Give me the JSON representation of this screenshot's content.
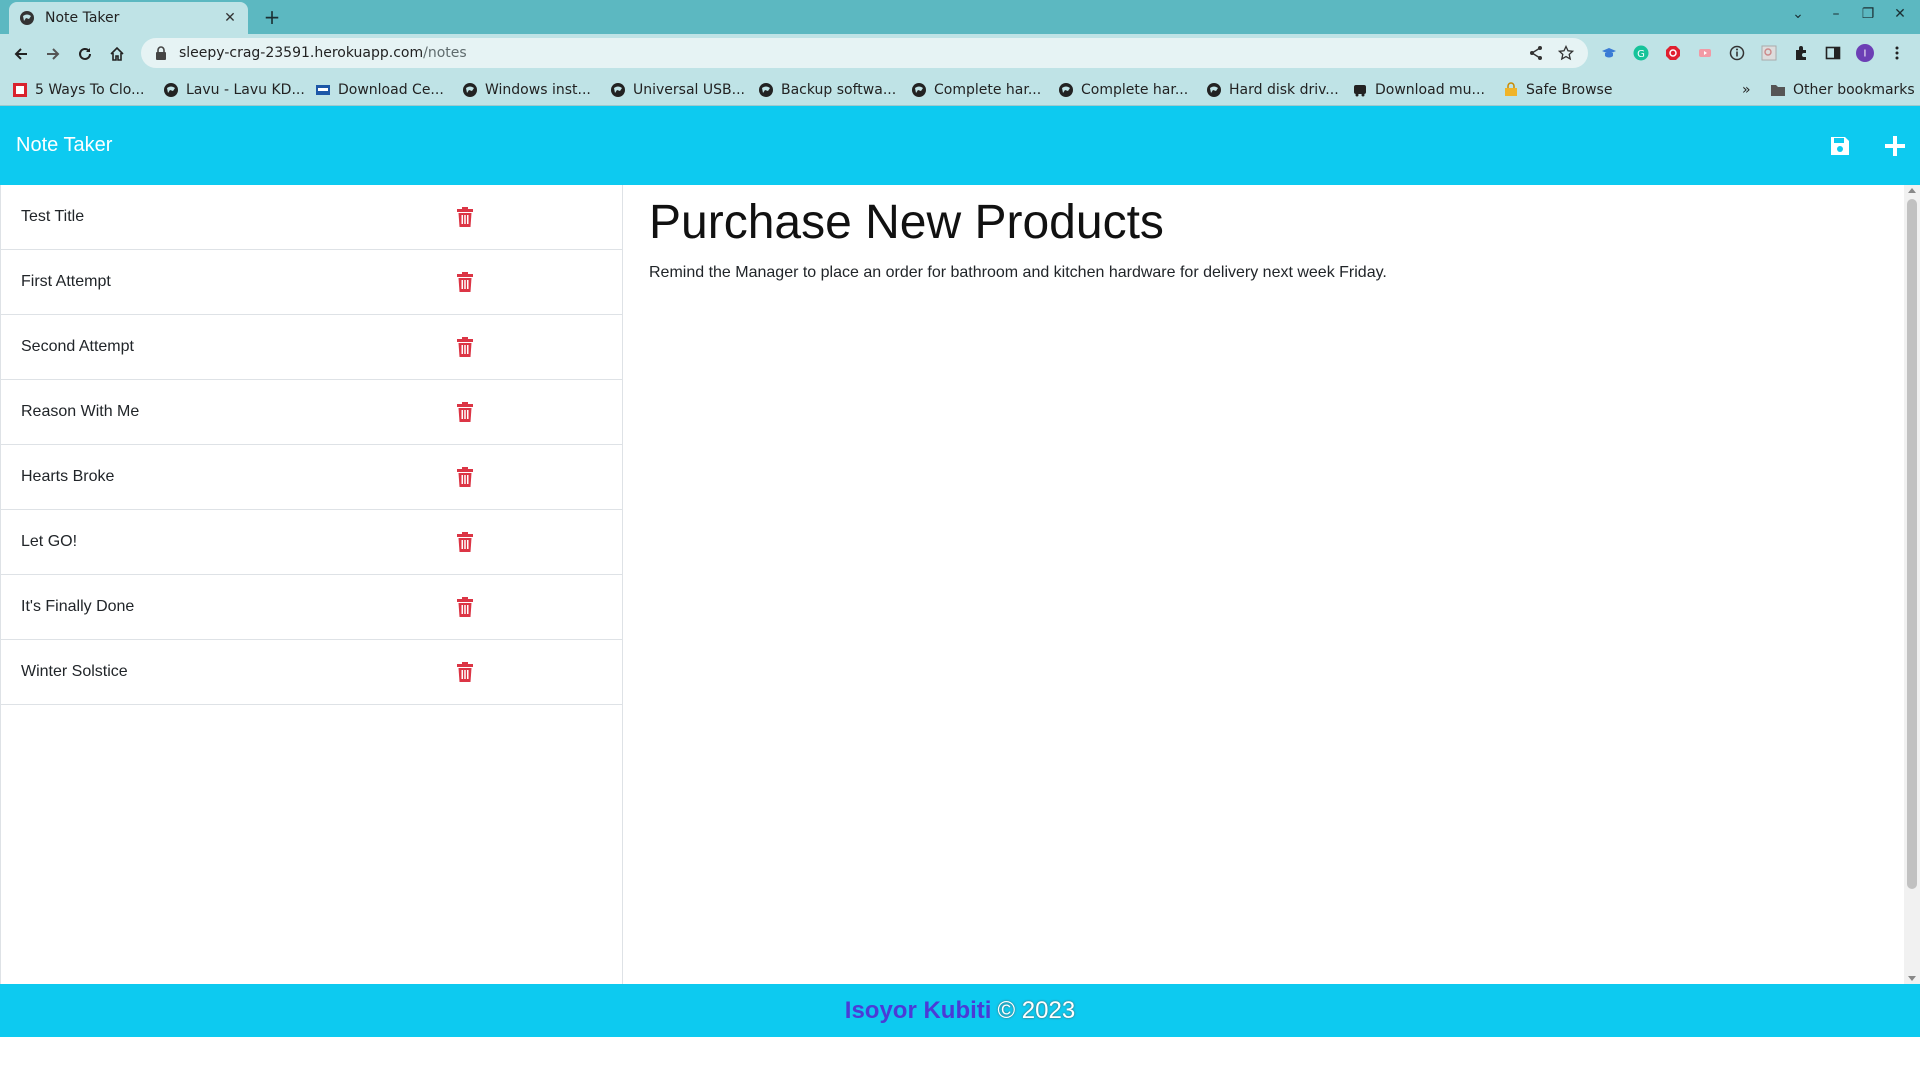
{
  "browser": {
    "tab_title": "Note Taker",
    "url_host": "sleepy-crag-23591.herokuapp.com",
    "url_path": "/notes",
    "bookmarks": [
      {
        "label": "5 Ways To Clo...",
        "icon": "red-square-icon"
      },
      {
        "label": "Lavu - Lavu KD...",
        "icon": "globe-icon"
      },
      {
        "label": "Download Ce...",
        "icon": "blue-badge-icon"
      },
      {
        "label": "Windows inst...",
        "icon": "globe-icon"
      },
      {
        "label": "Universal USB...",
        "icon": "globe-icon"
      },
      {
        "label": "Backup softwa...",
        "icon": "globe-icon"
      },
      {
        "label": "Complete har...",
        "icon": "globe-icon"
      },
      {
        "label": "Complete har...",
        "icon": "globe-icon"
      },
      {
        "label": "Hard disk driv...",
        "icon": "globe-icon"
      },
      {
        "label": "Download mu...",
        "icon": "bus-icon"
      },
      {
        "label": "Safe Browse",
        "icon": "lock-folder-icon"
      }
    ],
    "other_bookmarks": "Other bookmarks",
    "profile_initial": "I"
  },
  "app": {
    "brand": "Note Taker",
    "colors": {
      "primary": "#0dcaf0",
      "danger": "#dc3545"
    }
  },
  "notes": [
    {
      "title": "Test Title"
    },
    {
      "title": "First Attempt"
    },
    {
      "title": "Second Attempt"
    },
    {
      "title": "Reason With Me"
    },
    {
      "title": "Hearts Broke"
    },
    {
      "title": "Let GO!"
    },
    {
      "title": "It's Finally Done"
    },
    {
      "title": "Winter Solstice"
    }
  ],
  "active_note": {
    "title": "Purchase New Products",
    "text": "Remind the Manager to place an order for bathroom and kitchen hardware for delivery next week Friday."
  },
  "footer": {
    "author": "Isoyor Kubiti",
    "copyright": "© 2023"
  }
}
